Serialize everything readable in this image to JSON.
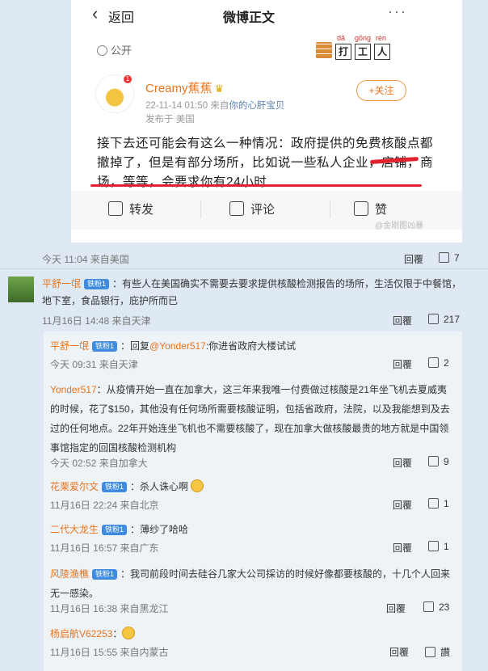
{
  "screenshot": {
    "back_label": "返回",
    "title": "微博正文",
    "more_icon": "···",
    "visibility": "公开",
    "stamp": {
      "pinyin": [
        "dǎ",
        "gōng",
        "rén"
      ],
      "chars": [
        "打",
        "工",
        "人"
      ]
    },
    "author_name": "Creamy蕉蕉",
    "crown_icon": "crown-icon",
    "avatar_badge": "1",
    "post_time": "22-11-14 01:50",
    "post_source_prefix": "来自",
    "post_source": "你的心肝宝贝",
    "published_at": "发布于 美国",
    "follow_label": "+关注",
    "post_text": "接下去还可能会有这么一种情况：政府提供的免费核酸点都撤掉了，但是有部分场所，比如说一些私人企业，店铺，商场，等等，会要求你有24小时",
    "actions": {
      "repost": "转发",
      "comment": "评论",
      "like": "赞"
    },
    "watermark": "@金刚图凶暴"
  },
  "post_meta": {
    "time": "今天 11:04 来自美国",
    "reply_label": "回覆",
    "likes": "7"
  },
  "comments": [
    {
      "user": "平舒一氓",
      "badge": "铁粉1",
      "text": "：有些人在美国确实不需要去要求提供核酸检测报告的场所，生活仅限于中餐馆，地下室，食品银行，庇护所而已",
      "meta": "11月16日 14:48 来自天津",
      "reply_label": "回覆",
      "likes": "217"
    }
  ],
  "replies": [
    {
      "user": "平舒一氓",
      "badge": "铁粉1",
      "prefix": "：回复",
      "mention": "@Yonder517",
      "text": ":你进省政府大楼试试",
      "meta": "今天 09:31 来自天津",
      "reply_label": "回覆",
      "likes": "2"
    },
    {
      "user": "Yonder517",
      "text": "：从疫情开始一直在加拿大，这三年来我唯一付费做过核酸是21年坐飞机去夏威夷的时候，花了$150，其他没有任何场所需要核酸证明，包括省政府，法院，以及我能想到及去过的任何地点。22年开始连坐飞机也不需要核酸了，现在加拿大做核酸最贵的地方就是中国领事馆指定的回国核酸检测机构",
      "meta": "今天 02:52 来自加拿大",
      "reply_label": "回覆",
      "likes": "9"
    },
    {
      "user": "花栗爱尔文",
      "badge": "铁粉1",
      "text": "：杀人诛心啊",
      "meta": "11月16日 22:24 来自北京",
      "reply_label": "回覆",
      "likes": "1"
    },
    {
      "user": "二代大龙生",
      "badge": "铁粉1",
      "text": "：薄纱了哈哈",
      "meta": "11月16日 16:57 来自广东",
      "reply_label": "回覆",
      "likes": "1"
    },
    {
      "user": "风陵渔樵",
      "badge": "铁粉1",
      "text": "：我司前段时间去硅谷几家大公司採访的时候好像都要核酸的，十几个人回来无一感染。",
      "meta": "11月16日 16:38 来自黑龙江",
      "reply_label": "回覆",
      "likes": "23"
    },
    {
      "user": "杨启航V62253",
      "text": "：",
      "meta": "11月16日 15:55 来自内蒙古",
      "reply_label": "回覆",
      "likes": "讚"
    }
  ]
}
